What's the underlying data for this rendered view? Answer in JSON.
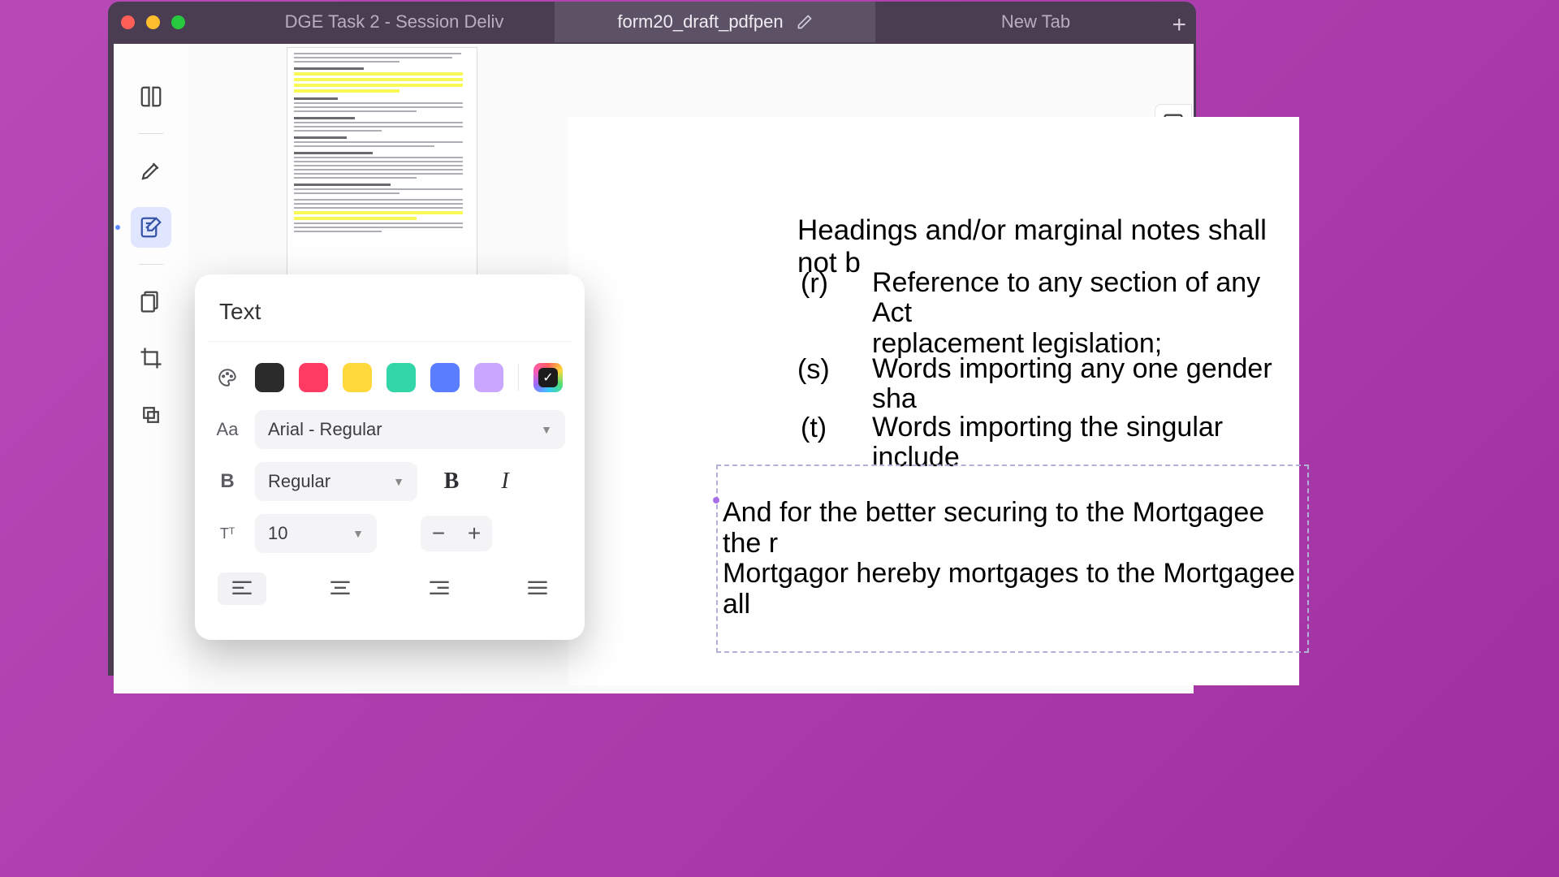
{
  "tabs": {
    "left": "DGE Task 2 - Session Deliv",
    "middle": "form20_draft_pdfpen",
    "right": "New Tab"
  },
  "popover": {
    "title": "Text",
    "font": "Arial - Regular",
    "weight": "Regular",
    "size": "10",
    "colors": {
      "black": "#2b2b2b",
      "red": "#ff3b63",
      "yellow": "#ffd93b",
      "teal": "#33d6a9",
      "blue": "#5b7dff",
      "purple": "#c9a6ff"
    }
  },
  "document": {
    "heading": "Headings and/or marginal notes shall not b",
    "r_label": "(r)",
    "r_body": "Reference to any section of any Act\nreplacement legislation;",
    "s_label": "(s)",
    "s_body": "Words importing any one gender sha",
    "t_label": "(t)",
    "t_body": "Words importing the singular include",
    "editing": "And for the better securing to the Mortgagee the r\nMortgagor hereby mortgages to the Mortgagee all"
  }
}
